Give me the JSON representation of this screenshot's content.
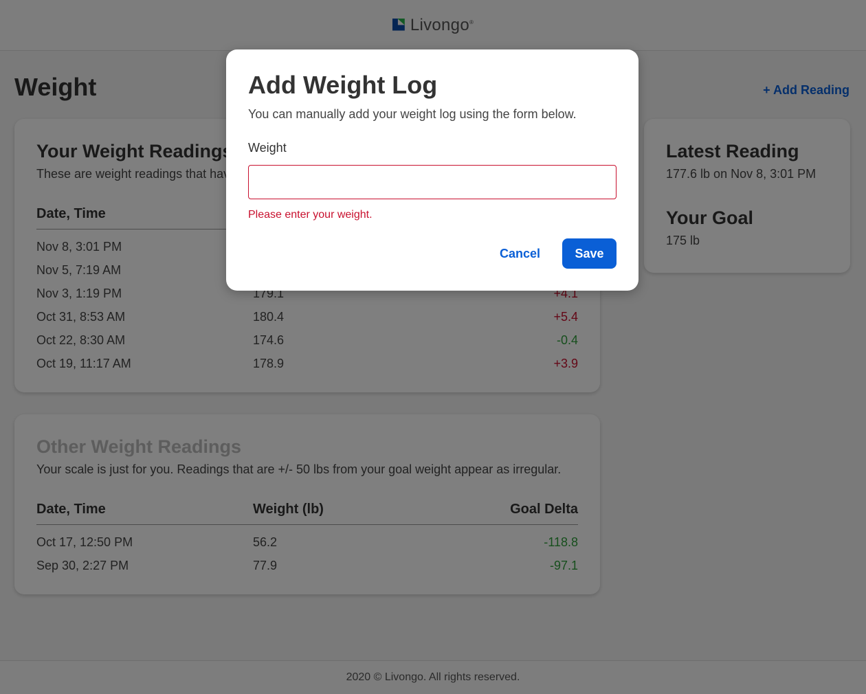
{
  "header": {
    "brand": "Livongo",
    "trademark": "®"
  },
  "page": {
    "title": "Weight",
    "add_reading": "+ Add Reading"
  },
  "your_readings": {
    "title": "Your Weight Readings",
    "subtitle": "These are weight readings that hav",
    "columns": {
      "date": "Date, Time",
      "weight": "",
      "delta": ""
    },
    "rows": [
      {
        "date": "Nov 8, 3:01 PM",
        "weight": "",
        "delta": "",
        "sign": ""
      },
      {
        "date": "Nov 5, 7:19 AM",
        "weight": "",
        "delta": "",
        "sign": ""
      },
      {
        "date": "Nov 3, 1:19 PM",
        "weight": "179.1",
        "delta": "+4.1",
        "sign": "pos"
      },
      {
        "date": "Oct 31, 8:53 AM",
        "weight": "180.4",
        "delta": "+5.4",
        "sign": "pos"
      },
      {
        "date": "Oct 22, 8:30 AM",
        "weight": "174.6",
        "delta": "-0.4",
        "sign": "neg"
      },
      {
        "date": "Oct 19, 11:17 AM",
        "weight": "178.9",
        "delta": "+3.9",
        "sign": "pos"
      }
    ]
  },
  "other_readings": {
    "title": "Other Weight Readings",
    "subtitle": "Your scale is just for you. Readings that are +/- 50 lbs from your goal weight appear as irregular.",
    "columns": {
      "date": "Date, Time",
      "weight": "Weight (lb)",
      "delta": "Goal Delta"
    },
    "rows": [
      {
        "date": "Oct 17, 12:50 PM",
        "weight": "56.2",
        "delta": "-118.8",
        "sign": "neg"
      },
      {
        "date": "Sep 30, 2:27 PM",
        "weight": "77.9",
        "delta": "-97.1",
        "sign": "neg"
      }
    ]
  },
  "side": {
    "latest_title": "Latest Reading",
    "latest_value": "177.6 lb on Nov 8, 3:01 PM",
    "goal_title": "Your Goal",
    "goal_value": "175 lb"
  },
  "modal": {
    "title": "Add Weight Log",
    "description": "You can manually add your weight log using the form below.",
    "field_label": "Weight",
    "field_value": "",
    "error": "Please enter your weight.",
    "cancel": "Cancel",
    "save": "Save"
  },
  "footer": {
    "text": "2020 © Livongo. All rights reserved."
  },
  "colors": {
    "accent": "#0a5fd6",
    "error": "#c8102e",
    "positive": "#c8102e",
    "negative": "#2e9e3a"
  }
}
